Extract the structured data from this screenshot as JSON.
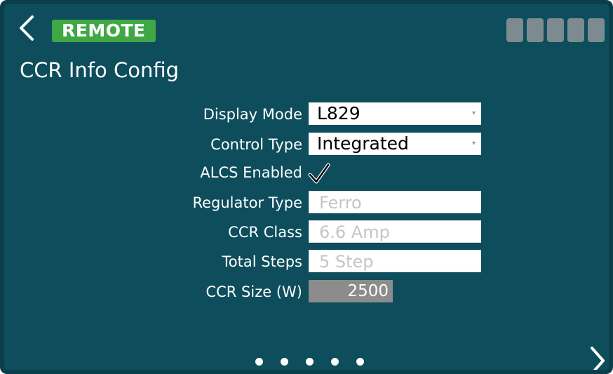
{
  "header": {
    "mode_badge": "REMOTE",
    "signal_segments": 5,
    "colors": {
      "background": "#0d4d5c",
      "badge": "#3fa844",
      "signal": "#7d8b90"
    }
  },
  "page": {
    "title": "CCR Info Config"
  },
  "form": {
    "display_mode": {
      "label": "Display Mode",
      "value": "L829"
    },
    "control_type": {
      "label": "Control Type",
      "value": "Integrated"
    },
    "alcs_enabled": {
      "label": "ALCS Enabled",
      "checked": true
    },
    "regulator_type": {
      "label": "Regulator Type",
      "value": "Ferro"
    },
    "ccr_class": {
      "label": "CCR Class",
      "value": "6.6 Amp"
    },
    "total_steps": {
      "label": "Total Steps",
      "value": "5 Step"
    },
    "ccr_size": {
      "label": "CCR Size (W)",
      "value": "2500"
    }
  },
  "pager": {
    "page_count": 5,
    "icons": {
      "back": "chevron-left-icon",
      "next": "chevron-right-icon"
    }
  }
}
